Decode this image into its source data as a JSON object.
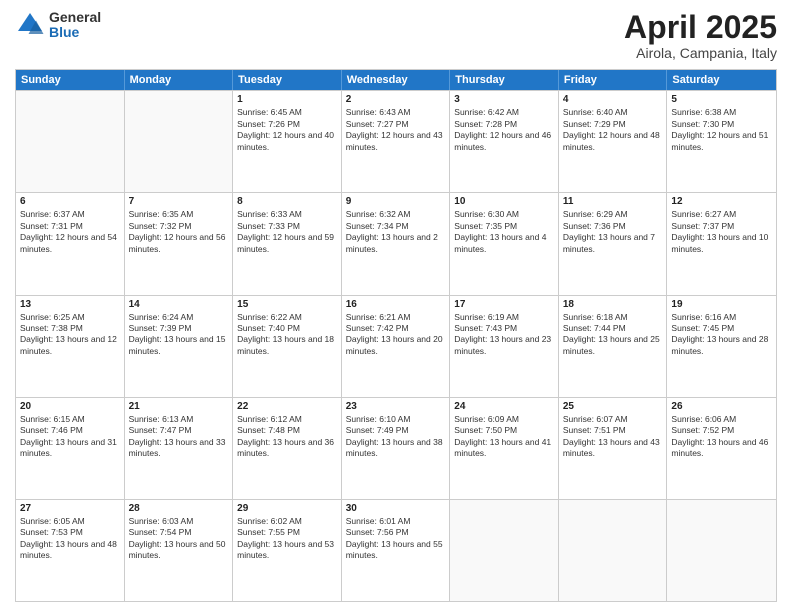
{
  "logo": {
    "general": "General",
    "blue": "Blue"
  },
  "header": {
    "month": "April 2025",
    "location": "Airola, Campania, Italy"
  },
  "weekdays": [
    "Sunday",
    "Monday",
    "Tuesday",
    "Wednesday",
    "Thursday",
    "Friday",
    "Saturday"
  ],
  "weeks": [
    [
      {
        "day": "",
        "sunrise": "",
        "sunset": "",
        "daylight": ""
      },
      {
        "day": "",
        "sunrise": "",
        "sunset": "",
        "daylight": ""
      },
      {
        "day": "1",
        "sunrise": "Sunrise: 6:45 AM",
        "sunset": "Sunset: 7:26 PM",
        "daylight": "Daylight: 12 hours and 40 minutes."
      },
      {
        "day": "2",
        "sunrise": "Sunrise: 6:43 AM",
        "sunset": "Sunset: 7:27 PM",
        "daylight": "Daylight: 12 hours and 43 minutes."
      },
      {
        "day": "3",
        "sunrise": "Sunrise: 6:42 AM",
        "sunset": "Sunset: 7:28 PM",
        "daylight": "Daylight: 12 hours and 46 minutes."
      },
      {
        "day": "4",
        "sunrise": "Sunrise: 6:40 AM",
        "sunset": "Sunset: 7:29 PM",
        "daylight": "Daylight: 12 hours and 48 minutes."
      },
      {
        "day": "5",
        "sunrise": "Sunrise: 6:38 AM",
        "sunset": "Sunset: 7:30 PM",
        "daylight": "Daylight: 12 hours and 51 minutes."
      }
    ],
    [
      {
        "day": "6",
        "sunrise": "Sunrise: 6:37 AM",
        "sunset": "Sunset: 7:31 PM",
        "daylight": "Daylight: 12 hours and 54 minutes."
      },
      {
        "day": "7",
        "sunrise": "Sunrise: 6:35 AM",
        "sunset": "Sunset: 7:32 PM",
        "daylight": "Daylight: 12 hours and 56 minutes."
      },
      {
        "day": "8",
        "sunrise": "Sunrise: 6:33 AM",
        "sunset": "Sunset: 7:33 PM",
        "daylight": "Daylight: 12 hours and 59 minutes."
      },
      {
        "day": "9",
        "sunrise": "Sunrise: 6:32 AM",
        "sunset": "Sunset: 7:34 PM",
        "daylight": "Daylight: 13 hours and 2 minutes."
      },
      {
        "day": "10",
        "sunrise": "Sunrise: 6:30 AM",
        "sunset": "Sunset: 7:35 PM",
        "daylight": "Daylight: 13 hours and 4 minutes."
      },
      {
        "day": "11",
        "sunrise": "Sunrise: 6:29 AM",
        "sunset": "Sunset: 7:36 PM",
        "daylight": "Daylight: 13 hours and 7 minutes."
      },
      {
        "day": "12",
        "sunrise": "Sunrise: 6:27 AM",
        "sunset": "Sunset: 7:37 PM",
        "daylight": "Daylight: 13 hours and 10 minutes."
      }
    ],
    [
      {
        "day": "13",
        "sunrise": "Sunrise: 6:25 AM",
        "sunset": "Sunset: 7:38 PM",
        "daylight": "Daylight: 13 hours and 12 minutes."
      },
      {
        "day": "14",
        "sunrise": "Sunrise: 6:24 AM",
        "sunset": "Sunset: 7:39 PM",
        "daylight": "Daylight: 13 hours and 15 minutes."
      },
      {
        "day": "15",
        "sunrise": "Sunrise: 6:22 AM",
        "sunset": "Sunset: 7:40 PM",
        "daylight": "Daylight: 13 hours and 18 minutes."
      },
      {
        "day": "16",
        "sunrise": "Sunrise: 6:21 AM",
        "sunset": "Sunset: 7:42 PM",
        "daylight": "Daylight: 13 hours and 20 minutes."
      },
      {
        "day": "17",
        "sunrise": "Sunrise: 6:19 AM",
        "sunset": "Sunset: 7:43 PM",
        "daylight": "Daylight: 13 hours and 23 minutes."
      },
      {
        "day": "18",
        "sunrise": "Sunrise: 6:18 AM",
        "sunset": "Sunset: 7:44 PM",
        "daylight": "Daylight: 13 hours and 25 minutes."
      },
      {
        "day": "19",
        "sunrise": "Sunrise: 6:16 AM",
        "sunset": "Sunset: 7:45 PM",
        "daylight": "Daylight: 13 hours and 28 minutes."
      }
    ],
    [
      {
        "day": "20",
        "sunrise": "Sunrise: 6:15 AM",
        "sunset": "Sunset: 7:46 PM",
        "daylight": "Daylight: 13 hours and 31 minutes."
      },
      {
        "day": "21",
        "sunrise": "Sunrise: 6:13 AM",
        "sunset": "Sunset: 7:47 PM",
        "daylight": "Daylight: 13 hours and 33 minutes."
      },
      {
        "day": "22",
        "sunrise": "Sunrise: 6:12 AM",
        "sunset": "Sunset: 7:48 PM",
        "daylight": "Daylight: 13 hours and 36 minutes."
      },
      {
        "day": "23",
        "sunrise": "Sunrise: 6:10 AM",
        "sunset": "Sunset: 7:49 PM",
        "daylight": "Daylight: 13 hours and 38 minutes."
      },
      {
        "day": "24",
        "sunrise": "Sunrise: 6:09 AM",
        "sunset": "Sunset: 7:50 PM",
        "daylight": "Daylight: 13 hours and 41 minutes."
      },
      {
        "day": "25",
        "sunrise": "Sunrise: 6:07 AM",
        "sunset": "Sunset: 7:51 PM",
        "daylight": "Daylight: 13 hours and 43 minutes."
      },
      {
        "day": "26",
        "sunrise": "Sunrise: 6:06 AM",
        "sunset": "Sunset: 7:52 PM",
        "daylight": "Daylight: 13 hours and 46 minutes."
      }
    ],
    [
      {
        "day": "27",
        "sunrise": "Sunrise: 6:05 AM",
        "sunset": "Sunset: 7:53 PM",
        "daylight": "Daylight: 13 hours and 48 minutes."
      },
      {
        "day": "28",
        "sunrise": "Sunrise: 6:03 AM",
        "sunset": "Sunset: 7:54 PM",
        "daylight": "Daylight: 13 hours and 50 minutes."
      },
      {
        "day": "29",
        "sunrise": "Sunrise: 6:02 AM",
        "sunset": "Sunset: 7:55 PM",
        "daylight": "Daylight: 13 hours and 53 minutes."
      },
      {
        "day": "30",
        "sunrise": "Sunrise: 6:01 AM",
        "sunset": "Sunset: 7:56 PM",
        "daylight": "Daylight: 13 hours and 55 minutes."
      },
      {
        "day": "",
        "sunrise": "",
        "sunset": "",
        "daylight": ""
      },
      {
        "day": "",
        "sunrise": "",
        "sunset": "",
        "daylight": ""
      },
      {
        "day": "",
        "sunrise": "",
        "sunset": "",
        "daylight": ""
      }
    ]
  ]
}
